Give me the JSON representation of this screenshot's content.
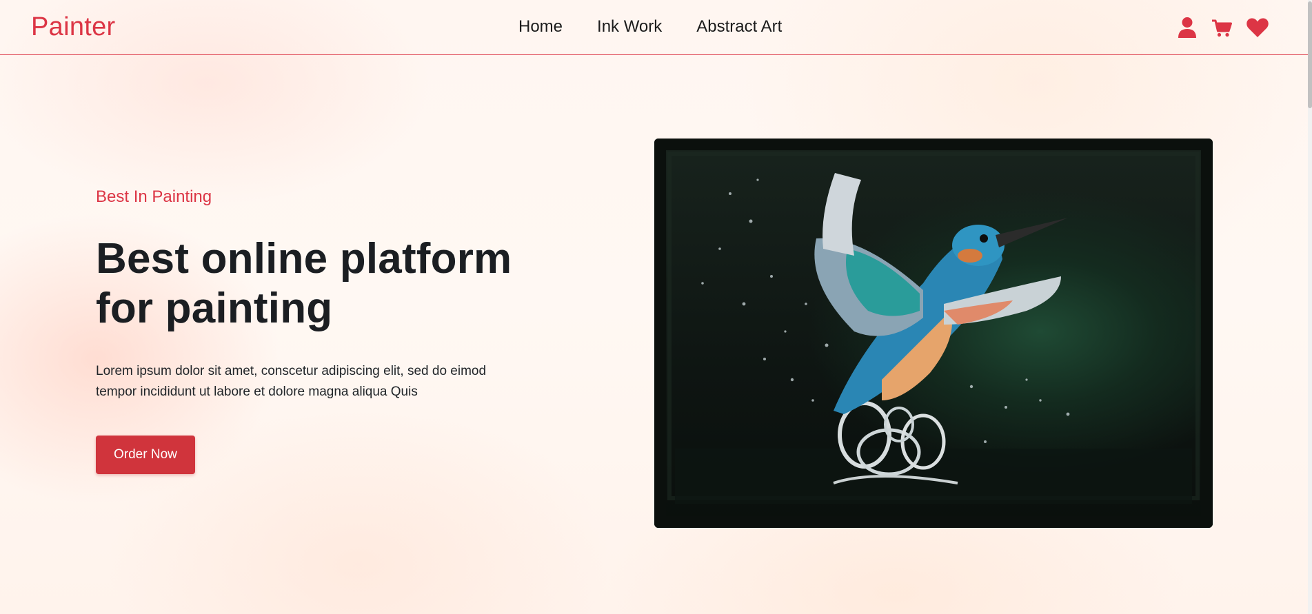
{
  "navbar": {
    "brand": "Painter",
    "links": [
      {
        "label": "Home"
      },
      {
        "label": "Ink Work"
      },
      {
        "label": "Abstract Art"
      }
    ],
    "icons": [
      "user-icon",
      "cart-icon",
      "heart-icon"
    ]
  },
  "hero": {
    "eyebrow": "Best In Painting",
    "headline_line1": "Best online platform",
    "headline_line2": "for painting",
    "description_line1": "Lorem ipsum dolor sit amet, conscetur adipiscing elit, sed do eimod",
    "description_line2": "tempor incididunt ut labore et dolore magna aliqua Quis",
    "cta_label": "Order Now",
    "image_subject": "kingfisher-painting"
  },
  "colors": {
    "accent": "#dc3545",
    "button": "#d0343c",
    "text_dark": "#1b1e22"
  }
}
